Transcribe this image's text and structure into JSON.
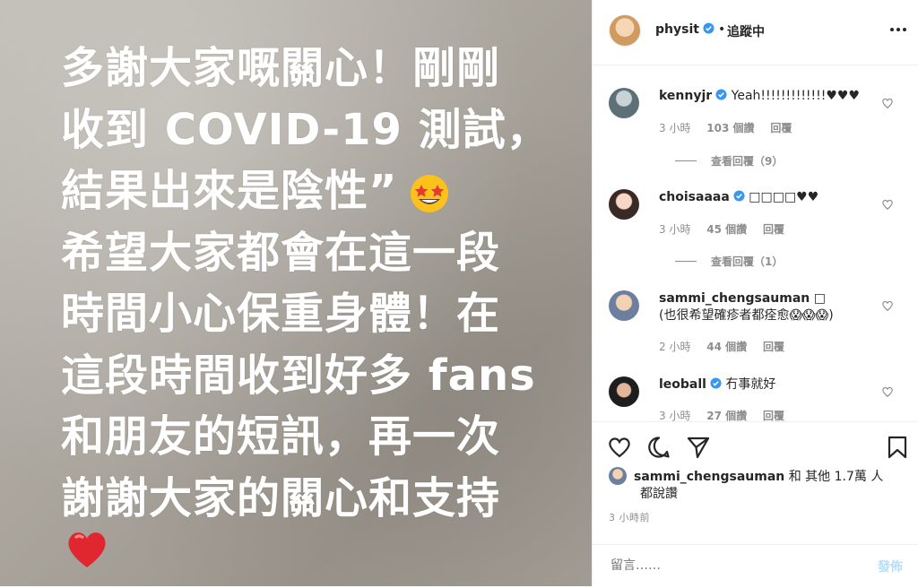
{
  "story": {
    "lines": [
      "多謝大家嘅關心！剛剛",
      "收到 COVID-19 測試，",
      "結果出來是陰性”",
      "希望大家都會在這一段",
      "時間小心保重身體！在",
      "這段時間收到好多 fans",
      "和朋友的短訊，再一次",
      "謝謝大家的關心和支持"
    ],
    "emoji_star": "star-struck-emoji",
    "emoji_heart": "red-heart-emoji"
  },
  "header": {
    "username": "physit",
    "separator": "•",
    "follow_label": "追蹤中"
  },
  "comments": [
    {
      "user": "kennyjr",
      "verified": true,
      "text": "Yeah!!!!!!!!!!!!!♥♥♥",
      "time": "3 小時",
      "likes": "103 個讚",
      "reply": "回覆",
      "view_replies": "查看回覆（9）"
    },
    {
      "user": "choisaaaa",
      "verified": true,
      "text": "□□□□♥♥",
      "time": "3 小時",
      "likes": "45 個讚",
      "reply": "回覆",
      "view_replies": "查看回覆（1）"
    },
    {
      "user": "sammi_chengsauman",
      "verified": false,
      "text": "□",
      "text2": "(也很希望確疹者都痊愈😱😱😱)",
      "time": "2 小時",
      "likes": "44 個讚",
      "reply": "回覆"
    },
    {
      "user": "leoball",
      "verified": true,
      "text": "冇事就好",
      "time": "3 小時",
      "likes": "27 個讚",
      "reply": "回覆"
    }
  ],
  "likes": {
    "user": "sammi_chengsauman",
    "rest": " 和 其他 1.7萬 人",
    "line2": "都說讚"
  },
  "timestamp": "3 小時前",
  "add_comment": {
    "placeholder": "留言……",
    "post_label": "發佈"
  },
  "colors": {
    "verified": "#3897f0",
    "post_disabled": "#b2dffc",
    "muted": "#8e8e8e"
  }
}
